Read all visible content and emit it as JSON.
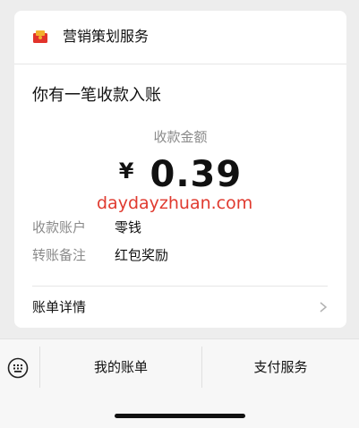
{
  "header": {
    "app_name": "营销策划服务",
    "icon": "red-envelope-icon"
  },
  "notice": {
    "headline": "你有一笔收款入账",
    "amount_label": "收款金额",
    "currency_symbol": "¥",
    "amount": "0.39"
  },
  "watermark": "daydayzhuan.com",
  "details": [
    {
      "key": "收款账户",
      "value": "零钱"
    },
    {
      "key": "转账备注",
      "value": "红包奖励"
    }
  ],
  "bill_link": {
    "label": "账单详情",
    "icon": "chevron-right-icon"
  },
  "bottom_menu": {
    "keyboard_icon": "keyboard-icon",
    "items": [
      {
        "label": "我的账单"
      },
      {
        "label": "支付服务"
      }
    ]
  },
  "colors": {
    "background": "#ededed",
    "card": "#ffffff",
    "muted_text": "#8a8a8a",
    "watermark": "#e03a2f",
    "icon_gold": "#f2b02e",
    "icon_red": "#e2332b"
  }
}
